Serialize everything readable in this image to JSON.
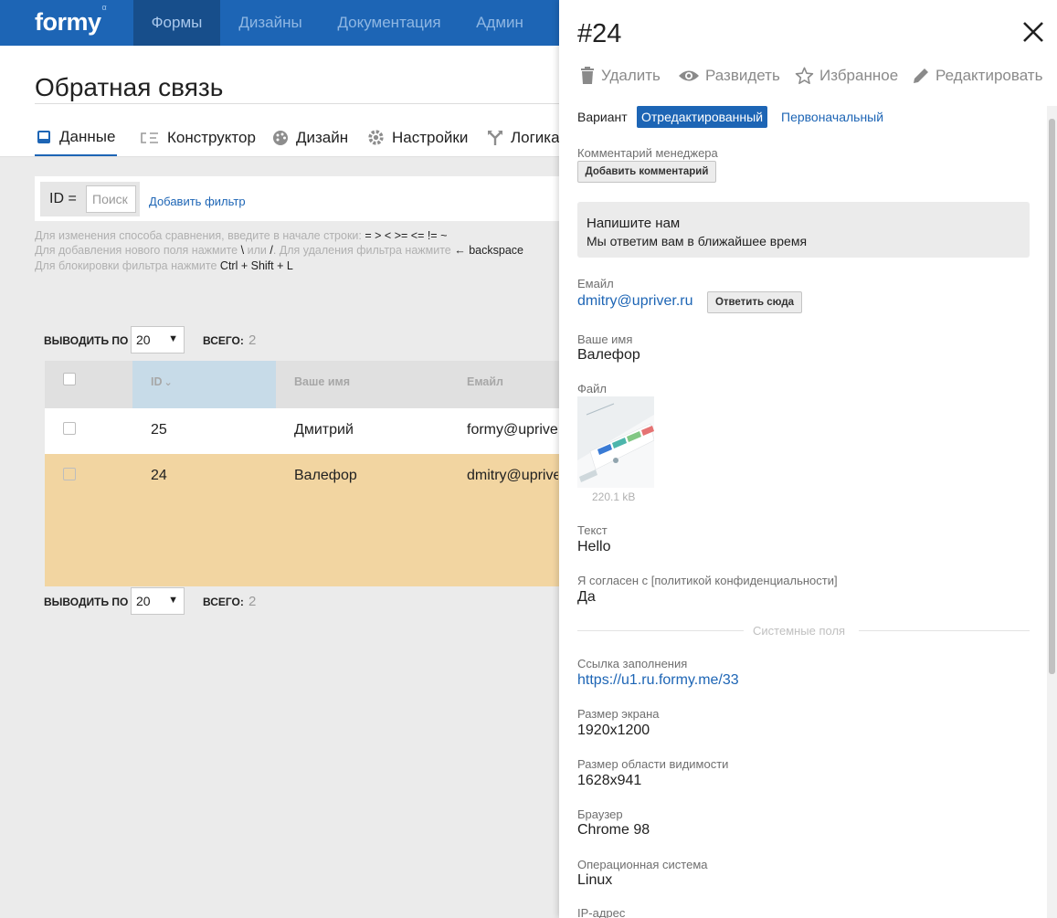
{
  "app": {
    "logo": "formy",
    "logo_superscript": "α",
    "nav": [
      "Формы",
      "Дизайны",
      "Документация",
      "Админ"
    ]
  },
  "page": {
    "title": "Обратная связь",
    "tabs": [
      "Данные",
      "Конструктор",
      "Дизайн",
      "Настройки",
      "Логика"
    ]
  },
  "filter": {
    "label": "ID =",
    "placeholder": "Поиск",
    "add_filter": "Добавить фильтр",
    "hints": {
      "line1_text": "Для изменения способа сравнения, введите в начале строки:",
      "line1_ops": "= > < >= <= != ~",
      "line2_part1": "Для добавления нового поля нажмите",
      "line2_key1": "\\",
      "line2_or": "или",
      "line2_key2": "/",
      "line2_part2": ". Для удаления фильтра нажмите",
      "line2_key3": "← backspace",
      "line3_text": "Для блокировки фильтра нажмите",
      "line3_keys": "Ctrl + Shift + L"
    }
  },
  "pagination": {
    "per_page_label": "ВЫВОДИТЬ ПО",
    "per_page_value": "20",
    "total_label": "ВСЕГО:",
    "total_value": "2"
  },
  "table": {
    "columns": [
      "ID",
      "Ваше имя",
      "Емайл"
    ],
    "sort_indicator": "⌄",
    "rows": [
      {
        "id": "25",
        "name": "Дмитрий",
        "email": "formy@upriver.ru"
      },
      {
        "id": "24",
        "name": "Валефор",
        "email": "dmitry@upriver.ru"
      }
    ],
    "highlight_color": "#f2d5a1"
  },
  "panel": {
    "title": "#24",
    "actions": {
      "delete": "Удалить",
      "split": "Развидеть",
      "favorite": "Избранное",
      "edit": "Редактировать"
    },
    "variant": {
      "label": "Вариант",
      "edited": "Отредактированный",
      "original": "Первоначальный"
    },
    "manager_comment": {
      "label": "Комментарий менеджера",
      "button": "Добавить комментарий"
    },
    "form_header": {
      "title": "Напишите нам",
      "subtitle": "Мы ответим вам в ближайшее время"
    },
    "fields": {
      "email_label": "Емайл",
      "email_value": "dmitry@upriver.ru",
      "reply_button": "Ответить сюда",
      "name_label": "Ваше имя",
      "name_value": "Валефор",
      "file_label": "Файл",
      "file_size": "220.1 kB",
      "text_label": "Текст",
      "text_value": "Hello",
      "consent_label": "Я согласен с [политикой конфиденциальности]",
      "consent_value": "Да"
    },
    "system": {
      "divider": "Системные поля",
      "link_label": "Ссылка заполнения",
      "link_value": "https://u1.ru.formy.me/33",
      "screen_label": "Размер экрана",
      "screen_value": "1920x1200",
      "viewport_label": "Размер области видимости",
      "viewport_value": "1628x941",
      "browser_label": "Браузер",
      "browser_value": "Chrome 98",
      "os_label": "Операционная система",
      "os_value": "Linux",
      "ip_label": "IP-адрес"
    }
  },
  "colors": {
    "brand": "#1d65b5",
    "nav_active": "#174e8b",
    "row_highlight": "#f2d5a1"
  }
}
